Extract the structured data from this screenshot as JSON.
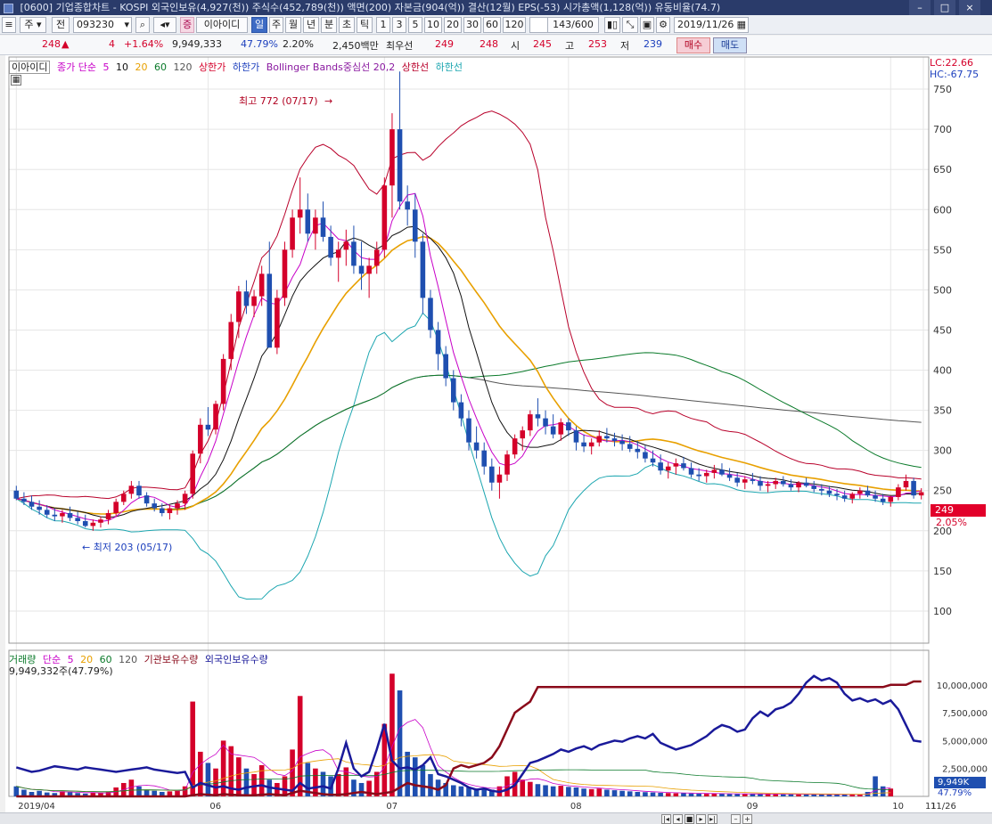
{
  "titlebar": {
    "text": "[0600] 기업종합차트 - KOSPI 외국인보유(4,927(천)) 주식수(452,789(천)) 액면(200) 자본금(904(억)) 결산(12월) EPS(-53) 시가총액(1,128(억)) 유동비율(74.7)",
    "close_label": "×"
  },
  "toolbar": {
    "market": "주",
    "prefix": "전",
    "code": "093230",
    "badge": "증",
    "name": "이아이디",
    "periods": [
      "일",
      "주",
      "월",
      "년",
      "분",
      "초",
      "틱"
    ],
    "active_period": "일",
    "intervals": [
      "1",
      "3",
      "5",
      "10",
      "20",
      "30",
      "60",
      "120"
    ],
    "count": "143/600",
    "date": "2019/11/26"
  },
  "info": {
    "price": "248",
    "change_arrow": "▲",
    "change": "4",
    "change_pct": "+1.64%",
    "volume": "9,949,333",
    "vol_ratio": "47.79%",
    "turnover": "2.20%",
    "amount": "2,450백만",
    "best_label": "최우선",
    "ask": "249",
    "bid": "248",
    "open_label": "시",
    "open": "245",
    "high_label": "고",
    "high": "253",
    "low_label": "저",
    "low": "239",
    "buy_label": "매수",
    "sell_label": "매도"
  },
  "legend": {
    "name": "이아이디",
    "price_label": "종가 단순",
    "ma5": "5",
    "ma10": "10",
    "ma20": "20",
    "ma60": "60",
    "ma120": "120",
    "upper_limit": "상한가",
    "lower_limit": "하한가",
    "bollinger": "Bollinger Bands중심선 20,2",
    "upper_band": "상한선",
    "lower_band": "하한선",
    "lc": "LC:22.66",
    "hc": "HC:-67.75"
  },
  "annotations": {
    "high": "최고 772 (07/17)",
    "low": "최저 203 (05/17)",
    "last_price": "249",
    "last_pct": "2.05%"
  },
  "volume_legend": {
    "label": "거래량",
    "type": "단순",
    "p5": "5",
    "p20": "20",
    "p60": "60",
    "p120": "120",
    "inst": "기관보유수량",
    "foreign": "외국인보유수량",
    "current": "9,949,332주(47.79%)",
    "last_box": "9,949K",
    "last_pct": "47.79%"
  },
  "colors": {
    "up": "#d4002a",
    "down": "#1f4fb0",
    "ma5": "#c800c8",
    "ma10": "#111111",
    "ma20": "#e8a000",
    "ma60": "#0a7a2a",
    "ma120": "#555555",
    "bb_upper": "#b8002a",
    "bb_lower": "#1ca6b0",
    "inst": "#8a0a1a",
    "foreign": "#1a1a9a"
  },
  "chart_data": {
    "type": "candlestick",
    "x_ticks": [
      "2019/04",
      "06",
      "07",
      "08",
      "09",
      "10",
      "11",
      "11/26"
    ],
    "y_ticks": [
      100,
      150,
      200,
      250,
      300,
      350,
      400,
      450,
      500,
      550,
      600,
      650,
      700,
      750
    ],
    "ylim": [
      60,
      790
    ],
    "candles": [
      [
        250,
        256,
        238,
        240
      ],
      [
        240,
        248,
        232,
        236
      ],
      [
        236,
        244,
        226,
        230
      ],
      [
        230,
        238,
        220,
        226
      ],
      [
        226,
        232,
        216,
        220
      ],
      [
        220,
        228,
        212,
        218
      ],
      [
        218,
        226,
        210,
        222
      ],
      [
        222,
        230,
        212,
        216
      ],
      [
        216,
        224,
        208,
        212
      ],
      [
        212,
        220,
        204,
        206
      ],
      [
        206,
        214,
        200,
        210
      ],
      [
        210,
        218,
        204,
        214
      ],
      [
        214,
        226,
        208,
        222
      ],
      [
        222,
        240,
        218,
        236
      ],
      [
        236,
        250,
        232,
        246
      ],
      [
        246,
        262,
        240,
        256
      ],
      [
        256,
        262,
        240,
        244
      ],
      [
        244,
        248,
        230,
        234
      ],
      [
        234,
        240,
        224,
        228
      ],
      [
        228,
        234,
        218,
        222
      ],
      [
        222,
        232,
        214,
        228
      ],
      [
        228,
        238,
        220,
        234
      ],
      [
        234,
        250,
        226,
        246
      ],
      [
        246,
        300,
        240,
        296
      ],
      [
        296,
        340,
        284,
        332
      ],
      [
        332,
        354,
        318,
        326
      ],
      [
        326,
        362,
        320,
        358
      ],
      [
        358,
        420,
        350,
        414
      ],
      [
        414,
        470,
        400,
        460
      ],
      [
        460,
        505,
        440,
        498
      ],
      [
        498,
        512,
        470,
        480
      ],
      [
        480,
        500,
        466,
        492
      ],
      [
        492,
        530,
        480,
        520
      ],
      [
        520,
        560,
        470,
        428
      ],
      [
        428,
        500,
        420,
        490
      ],
      [
        490,
        560,
        480,
        550
      ],
      [
        550,
        600,
        540,
        590
      ],
      [
        590,
        640,
        570,
        600
      ],
      [
        600,
        620,
        560,
        570
      ],
      [
        570,
        600,
        550,
        590
      ],
      [
        590,
        610,
        560,
        566
      ],
      [
        566,
        580,
        530,
        540
      ],
      [
        540,
        560,
        510,
        550
      ],
      [
        550,
        575,
        530,
        560
      ],
      [
        560,
        580,
        520,
        530
      ],
      [
        530,
        560,
        500,
        520
      ],
      [
        520,
        540,
        490,
        530
      ],
      [
        530,
        560,
        520,
        550
      ],
      [
        550,
        640,
        540,
        630
      ],
      [
        630,
        720,
        590,
        700
      ],
      [
        700,
        772,
        600,
        610
      ],
      [
        610,
        630,
        580,
        600
      ],
      [
        600,
        620,
        540,
        560
      ],
      [
        560,
        570,
        470,
        490
      ],
      [
        490,
        500,
        440,
        450
      ],
      [
        450,
        460,
        400,
        420
      ],
      [
        420,
        430,
        380,
        390
      ],
      [
        390,
        400,
        350,
        360
      ],
      [
        360,
        370,
        330,
        340
      ],
      [
        340,
        350,
        300,
        310
      ],
      [
        310,
        330,
        290,
        300
      ],
      [
        300,
        310,
        270,
        280
      ],
      [
        280,
        290,
        250,
        260
      ],
      [
        260,
        280,
        240,
        270
      ],
      [
        270,
        300,
        262,
        295
      ],
      [
        295,
        320,
        290,
        315
      ],
      [
        315,
        330,
        300,
        325
      ],
      [
        325,
        350,
        318,
        345
      ],
      [
        345,
        365,
        330,
        340
      ],
      [
        340,
        350,
        320,
        330
      ],
      [
        330,
        345,
        315,
        320
      ],
      [
        320,
        340,
        312,
        335
      ],
      [
        335,
        340,
        318,
        325
      ],
      [
        325,
        330,
        300,
        310
      ],
      [
        310,
        320,
        298,
        305
      ],
      [
        305,
        315,
        295,
        310
      ],
      [
        310,
        325,
        305,
        318
      ],
      [
        318,
        328,
        310,
        315
      ],
      [
        315,
        322,
        305,
        312
      ],
      [
        312,
        320,
        300,
        308
      ],
      [
        308,
        318,
        298,
        302
      ],
      [
        302,
        312,
        290,
        298
      ],
      [
        298,
        306,
        285,
        290
      ],
      [
        290,
        300,
        280,
        285
      ],
      [
        285,
        295,
        270,
        275
      ],
      [
        275,
        285,
        265,
        280
      ],
      [
        280,
        290,
        270,
        284
      ],
      [
        284,
        292,
        275,
        278
      ],
      [
        278,
        285,
        266,
        270
      ],
      [
        270,
        278,
        262,
        268
      ],
      [
        268,
        276,
        260,
        272
      ],
      [
        272,
        282,
        265,
        276
      ],
      [
        276,
        284,
        268,
        270
      ],
      [
        270,
        278,
        262,
        266
      ],
      [
        266,
        272,
        255,
        260
      ],
      [
        260,
        268,
        252,
        264
      ],
      [
        264,
        272,
        258,
        262
      ],
      [
        262,
        268,
        250,
        256
      ],
      [
        256,
        262,
        248,
        258
      ],
      [
        258,
        266,
        252,
        262
      ],
      [
        262,
        268,
        255,
        258
      ],
      [
        258,
        264,
        250,
        254
      ],
      [
        254,
        262,
        248,
        260
      ],
      [
        260,
        266,
        254,
        256
      ],
      [
        256,
        262,
        248,
        252
      ],
      [
        252,
        258,
        244,
        250
      ],
      [
        250,
        256,
        242,
        246
      ],
      [
        246,
        252,
        238,
        244
      ],
      [
        244,
        250,
        236,
        240
      ],
      [
        240,
        248,
        234,
        246
      ],
      [
        246,
        254,
        240,
        250
      ],
      [
        250,
        256,
        242,
        244
      ],
      [
        244,
        250,
        236,
        240
      ],
      [
        240,
        246,
        232,
        236
      ],
      [
        236,
        244,
        230,
        242
      ],
      [
        242,
        258,
        238,
        254
      ],
      [
        254,
        270,
        250,
        262
      ],
      [
        262,
        266,
        240,
        244
      ],
      [
        244,
        253,
        239,
        248
      ]
    ],
    "volume_bars_k": [
      900,
      600,
      400,
      500,
      350,
      300,
      450,
      380,
      300,
      250,
      320,
      280,
      400,
      800,
      1200,
      1500,
      900,
      600,
      500,
      400,
      450,
      500,
      900,
      8500,
      4000,
      3000,
      2500,
      5000,
      4500,
      3500,
      2500,
      2000,
      2800,
      1500,
      1200,
      1800,
      4200,
      9000,
      3000,
      2500,
      2200,
      1800,
      2000,
      2600,
      1500,
      1200,
      1400,
      2200,
      6500,
      11000,
      9500,
      4000,
      3500,
      2800,
      2000,
      1500,
      1200,
      1000,
      900,
      800,
      700,
      650,
      600,
      900,
      1800,
      2200,
      1500,
      1300,
      1100,
      1000,
      900,
      950,
      850,
      800,
      700,
      650,
      700,
      600,
      550,
      500,
      450,
      400,
      380,
      350,
      320,
      300,
      280,
      300,
      260,
      240,
      230,
      250,
      240,
      220,
      200,
      210,
      230,
      220,
      200,
      190,
      180,
      200,
      190,
      180,
      170,
      160,
      170,
      180,
      170,
      160,
      150,
      400,
      1800,
      900,
      700
    ],
    "inst_holding_k": [
      0,
      0,
      0,
      0,
      0,
      0,
      0,
      0,
      0,
      0,
      0,
      0,
      0,
      0,
      0,
      0,
      0,
      0,
      0,
      0,
      0,
      0,
      0,
      100,
      200,
      150,
      100,
      200,
      150,
      120,
      100,
      100,
      150,
      200,
      150,
      100,
      300,
      500,
      400,
      300,
      200,
      150,
      150,
      200,
      300,
      400,
      300,
      200,
      300,
      400,
      800,
      1200,
      1000,
      900,
      800,
      600,
      1000,
      2500,
      2800,
      2600,
      2800,
      3000,
      3500,
      4500,
      6000,
      7500,
      8000,
      8500,
      9800,
      9800,
      9800,
      9800,
      9800,
      9800,
      9800,
      9800,
      9800,
      9800,
      9800,
      9800,
      9800,
      9800,
      9800,
      9800,
      9800,
      9800,
      9800,
      9800,
      9800,
      9800,
      9800,
      9800,
      9800,
      9800,
      9800,
      9800,
      9800,
      9800,
      9800,
      9800,
      9800,
      9800,
      9800,
      9800,
      9800,
      9800,
      9800,
      9800,
      9800,
      9800,
      9800,
      9800,
      9800,
      9800,
      10000,
      10000,
      10000,
      10300,
      10300
    ],
    "foreign_holding_k": [
      2600,
      2400,
      2200,
      2300,
      2500,
      2700,
      2600,
      2500,
      2400,
      2600,
      2500,
      2400,
      2300,
      2200,
      2300,
      2400,
      2500,
      2600,
      2400,
      2300,
      2200,
      2100,
      2200,
      800,
      1200,
      1000,
      800,
      900,
      700,
      600,
      800,
      900,
      1000,
      800,
      700,
      600,
      500,
      1200,
      700,
      800,
      900,
      700,
      2500,
      4800,
      2500,
      1800,
      2200,
      4200,
      6500,
      3200,
      2500,
      2600,
      2400,
      2800,
      3500,
      2000,
      1800,
      1500,
      1200,
      800,
      600,
      700,
      500,
      400,
      600,
      1000,
      2000,
      3000,
      3200,
      3500,
      3800,
      4200,
      4000,
      4300,
      4500,
      4200,
      4600,
      4800,
      5000,
      4900,
      5200,
      5400,
      5200,
      5600,
      4800,
      4500,
      4200,
      4400,
      4600,
      5000,
      5400,
      6000,
      6400,
      6200,
      5800,
      6000,
      7000,
      7600,
      7200,
      7800,
      8000,
      8400,
      9200,
      10200,
      10800,
      10400,
      10600,
      10200,
      9200,
      8600,
      8800,
      8500,
      8700,
      8300,
      8600,
      7800,
      6400,
      5000,
      4900
    ]
  }
}
